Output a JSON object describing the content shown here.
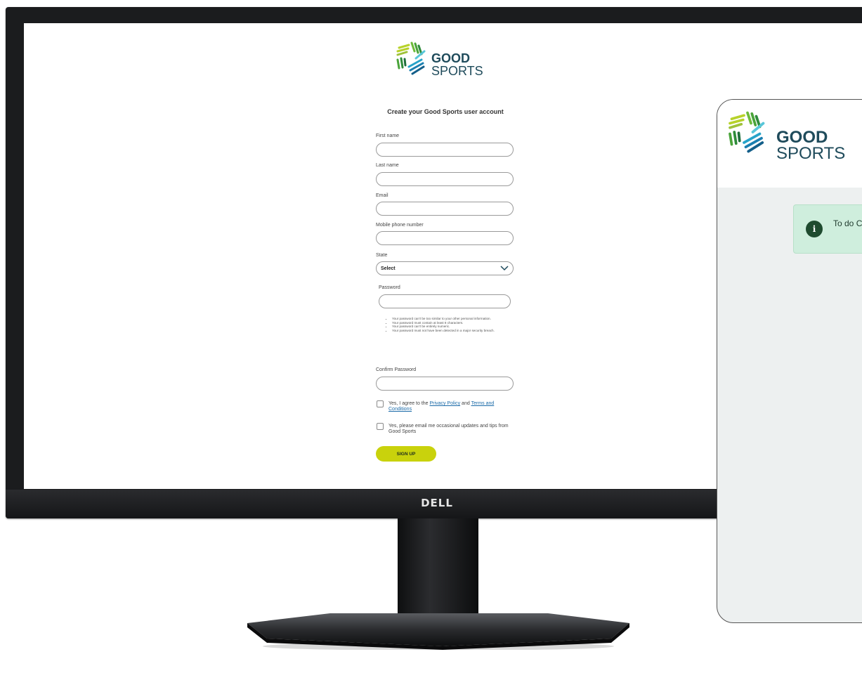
{
  "brand": {
    "logo_line1": "GOOD",
    "logo_line2": "SPORTS",
    "monitor_brand": "DELL"
  },
  "form": {
    "title": "Create your Good Sports user account",
    "fields": {
      "first_name": {
        "label": "First name",
        "value": ""
      },
      "last_name": {
        "label": "Last name",
        "value": ""
      },
      "email": {
        "label": "Email",
        "value": ""
      },
      "mobile": {
        "label": "Mobile phone number",
        "value": ""
      },
      "state": {
        "label": "State",
        "value": "Select"
      },
      "password": {
        "label": "Password",
        "value": ""
      },
      "confirm_password": {
        "label": "Confirm Password",
        "value": ""
      }
    },
    "password_rules": [
      "Your password can't be too similar to your other personal information.",
      "Your password must contain at least 8 characters.",
      "Your password can't be entirely numeric.",
      "Your password must not have been detected in a major security breach."
    ],
    "agree_checkbox": {
      "prefix": "Yes, I agree to the",
      "privacy_link": "Privacy Policy",
      "middle": "and",
      "terms_link": "Terms and Conditions",
      "checked": false
    },
    "updates_checkbox": {
      "label": "Yes, please email me occasional updates and tips from Good Sports",
      "checked": false
    },
    "submit_label": "SIGN UP"
  },
  "card": {
    "alert_text": "To do Club a"
  },
  "colors": {
    "accent": "#c9d20c",
    "logo_text": "#1f4b5b",
    "link": "#1a6aa8",
    "alert_bg": "#cfeedd",
    "alert_icon": "#1f4b2f"
  },
  "icons": {
    "select_arrow": "chevron-down-icon",
    "alert": "info-icon",
    "logo": "good-sports-logo-icon"
  }
}
